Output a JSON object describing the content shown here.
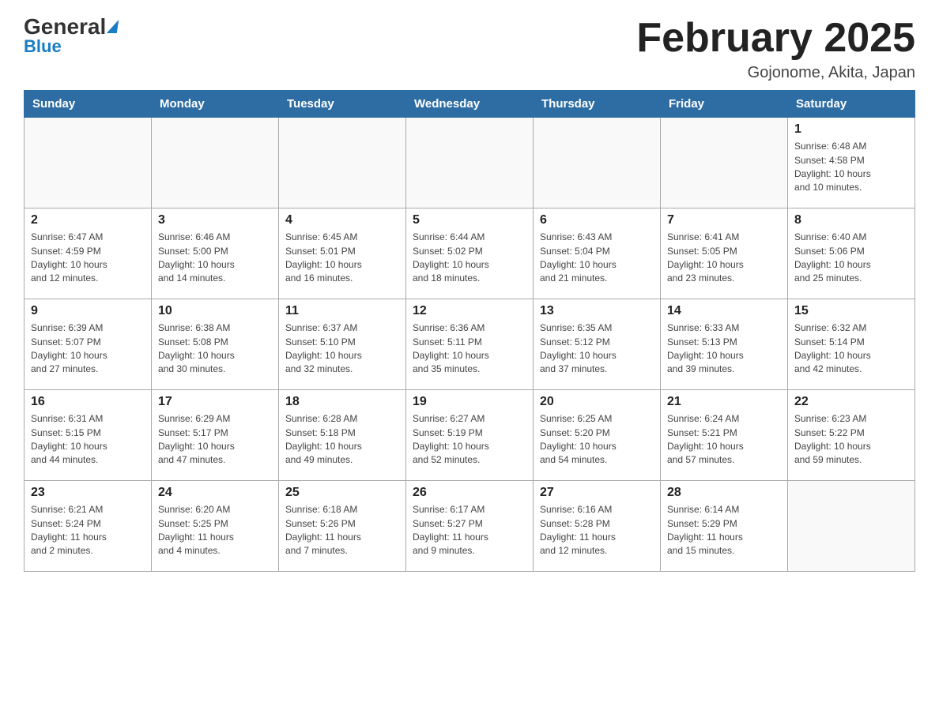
{
  "header": {
    "logo_top": "General",
    "logo_blue": "Blue",
    "month_title": "February 2025",
    "location": "Gojonome, Akita, Japan"
  },
  "days_of_week": [
    "Sunday",
    "Monday",
    "Tuesday",
    "Wednesday",
    "Thursday",
    "Friday",
    "Saturday"
  ],
  "weeks": [
    [
      {
        "day": "",
        "info": ""
      },
      {
        "day": "",
        "info": ""
      },
      {
        "day": "",
        "info": ""
      },
      {
        "day": "",
        "info": ""
      },
      {
        "day": "",
        "info": ""
      },
      {
        "day": "",
        "info": ""
      },
      {
        "day": "1",
        "info": "Sunrise: 6:48 AM\nSunset: 4:58 PM\nDaylight: 10 hours\nand 10 minutes."
      }
    ],
    [
      {
        "day": "2",
        "info": "Sunrise: 6:47 AM\nSunset: 4:59 PM\nDaylight: 10 hours\nand 12 minutes."
      },
      {
        "day": "3",
        "info": "Sunrise: 6:46 AM\nSunset: 5:00 PM\nDaylight: 10 hours\nand 14 minutes."
      },
      {
        "day": "4",
        "info": "Sunrise: 6:45 AM\nSunset: 5:01 PM\nDaylight: 10 hours\nand 16 minutes."
      },
      {
        "day": "5",
        "info": "Sunrise: 6:44 AM\nSunset: 5:02 PM\nDaylight: 10 hours\nand 18 minutes."
      },
      {
        "day": "6",
        "info": "Sunrise: 6:43 AM\nSunset: 5:04 PM\nDaylight: 10 hours\nand 21 minutes."
      },
      {
        "day": "7",
        "info": "Sunrise: 6:41 AM\nSunset: 5:05 PM\nDaylight: 10 hours\nand 23 minutes."
      },
      {
        "day": "8",
        "info": "Sunrise: 6:40 AM\nSunset: 5:06 PM\nDaylight: 10 hours\nand 25 minutes."
      }
    ],
    [
      {
        "day": "9",
        "info": "Sunrise: 6:39 AM\nSunset: 5:07 PM\nDaylight: 10 hours\nand 27 minutes."
      },
      {
        "day": "10",
        "info": "Sunrise: 6:38 AM\nSunset: 5:08 PM\nDaylight: 10 hours\nand 30 minutes."
      },
      {
        "day": "11",
        "info": "Sunrise: 6:37 AM\nSunset: 5:10 PM\nDaylight: 10 hours\nand 32 minutes."
      },
      {
        "day": "12",
        "info": "Sunrise: 6:36 AM\nSunset: 5:11 PM\nDaylight: 10 hours\nand 35 minutes."
      },
      {
        "day": "13",
        "info": "Sunrise: 6:35 AM\nSunset: 5:12 PM\nDaylight: 10 hours\nand 37 minutes."
      },
      {
        "day": "14",
        "info": "Sunrise: 6:33 AM\nSunset: 5:13 PM\nDaylight: 10 hours\nand 39 minutes."
      },
      {
        "day": "15",
        "info": "Sunrise: 6:32 AM\nSunset: 5:14 PM\nDaylight: 10 hours\nand 42 minutes."
      }
    ],
    [
      {
        "day": "16",
        "info": "Sunrise: 6:31 AM\nSunset: 5:15 PM\nDaylight: 10 hours\nand 44 minutes."
      },
      {
        "day": "17",
        "info": "Sunrise: 6:29 AM\nSunset: 5:17 PM\nDaylight: 10 hours\nand 47 minutes."
      },
      {
        "day": "18",
        "info": "Sunrise: 6:28 AM\nSunset: 5:18 PM\nDaylight: 10 hours\nand 49 minutes."
      },
      {
        "day": "19",
        "info": "Sunrise: 6:27 AM\nSunset: 5:19 PM\nDaylight: 10 hours\nand 52 minutes."
      },
      {
        "day": "20",
        "info": "Sunrise: 6:25 AM\nSunset: 5:20 PM\nDaylight: 10 hours\nand 54 minutes."
      },
      {
        "day": "21",
        "info": "Sunrise: 6:24 AM\nSunset: 5:21 PM\nDaylight: 10 hours\nand 57 minutes."
      },
      {
        "day": "22",
        "info": "Sunrise: 6:23 AM\nSunset: 5:22 PM\nDaylight: 10 hours\nand 59 minutes."
      }
    ],
    [
      {
        "day": "23",
        "info": "Sunrise: 6:21 AM\nSunset: 5:24 PM\nDaylight: 11 hours\nand 2 minutes."
      },
      {
        "day": "24",
        "info": "Sunrise: 6:20 AM\nSunset: 5:25 PM\nDaylight: 11 hours\nand 4 minutes."
      },
      {
        "day": "25",
        "info": "Sunrise: 6:18 AM\nSunset: 5:26 PM\nDaylight: 11 hours\nand 7 minutes."
      },
      {
        "day": "26",
        "info": "Sunrise: 6:17 AM\nSunset: 5:27 PM\nDaylight: 11 hours\nand 9 minutes."
      },
      {
        "day": "27",
        "info": "Sunrise: 6:16 AM\nSunset: 5:28 PM\nDaylight: 11 hours\nand 12 minutes."
      },
      {
        "day": "28",
        "info": "Sunrise: 6:14 AM\nSunset: 5:29 PM\nDaylight: 11 hours\nand 15 minutes."
      },
      {
        "day": "",
        "info": ""
      }
    ]
  ]
}
